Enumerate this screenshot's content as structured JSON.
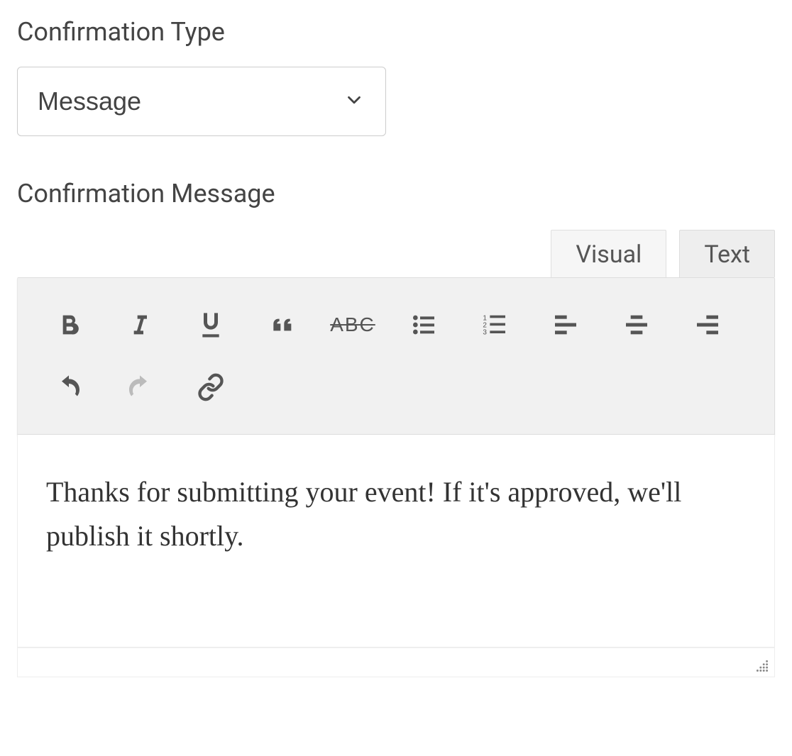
{
  "labels": {
    "confirmation_type": "Confirmation Type",
    "confirmation_message": "Confirmation Message"
  },
  "confirmation_type_select": {
    "value": "Message"
  },
  "editor": {
    "tabs": {
      "visual": "Visual",
      "text": "Text",
      "active": "visual"
    },
    "toolbar": {
      "bold": "bold",
      "italic": "italic",
      "underline": "underline",
      "blockquote": "blockquote",
      "strikethrough_label": "ABC",
      "bulleted_list": "bulleted-list",
      "numbered_list": "numbered-list",
      "align_left": "align-left",
      "align_center": "align-center",
      "align_right": "align-right",
      "undo": "undo",
      "redo": "redo",
      "link": "link"
    },
    "content": "Thanks for submitting your event! If it's approved, we'll publish it shortly."
  }
}
